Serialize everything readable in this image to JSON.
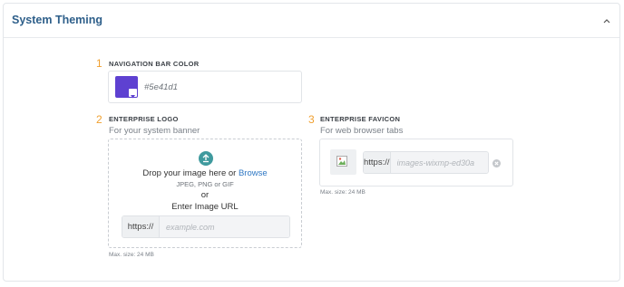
{
  "header": {
    "title": "System Theming"
  },
  "nav_color": {
    "number": "1",
    "label": "NAVIGATION BAR COLOR",
    "value": "#5e41d1",
    "swatch_color": "#5e41d1"
  },
  "logo": {
    "number": "2",
    "label": "ENTERPRISE LOGO",
    "subtitle": "For your system banner",
    "drop_text": "Drop your image here or ",
    "browse": "Browse",
    "formats": "JPEG, PNG or GIF",
    "or": "or",
    "enter_url": "Enter Image URL",
    "url_prefix": "https://",
    "url_placeholder": "example.com",
    "max_size": "Max. size: 24 MB"
  },
  "favicon": {
    "number": "3",
    "label": "ENTERPRISE FAVICON",
    "subtitle": "For web browser tabs",
    "url_prefix": "https://",
    "url_value": "images-wixmp-ed30a",
    "max_size": "Max. size: 24 MB"
  },
  "colors": {
    "accent_number": "#f0a030",
    "title": "#2e5f8a",
    "link": "#2f78c4",
    "upload_icon": "#3f9a9e"
  }
}
